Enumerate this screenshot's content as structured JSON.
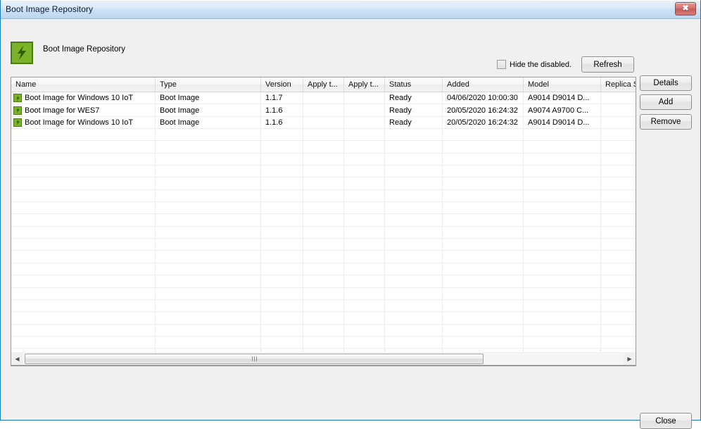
{
  "window": {
    "title": "Boot Image Repository",
    "close_icon": "close-icon",
    "close_glyph": "✖"
  },
  "header": {
    "icon": "lightning-bolt-icon",
    "caption": "Boot Image Repository"
  },
  "toolbar": {
    "hide_disabled_label": "Hide the disabled.",
    "hide_disabled_checked": false,
    "refresh_label": "Refresh"
  },
  "side_buttons": {
    "details_label": "Details",
    "add_label": "Add",
    "remove_label": "Remove"
  },
  "footer": {
    "close_label": "Close"
  },
  "grid": {
    "columns": [
      "Name",
      "Type",
      "Version",
      "Apply t...",
      "Apply t...",
      "Status",
      "Added",
      "Model",
      "Replica St"
    ],
    "rows": [
      {
        "icon": "lightning-bolt-icon",
        "name": "Boot Image for Windows 10 IoT",
        "type": "Boot Image",
        "version": "1.1.7",
        "apply_to_1": "",
        "apply_to_2": "",
        "status": "Ready",
        "added": "04/06/2020 10:00:30",
        "model": "A9014 D9014 D...",
        "replica_status": ""
      },
      {
        "icon": "lightning-bolt-icon",
        "name": "Boot Image for WES7",
        "type": "Boot Image",
        "version": "1.1.6",
        "apply_to_1": "",
        "apply_to_2": "",
        "status": "Ready",
        "added": "20/05/2020 16:24:32",
        "model": "A9074 A9700 C...",
        "replica_status": ""
      },
      {
        "icon": "lightning-bolt-icon",
        "name": "Boot Image for Windows 10 IoT",
        "type": "Boot Image",
        "version": "1.1.6",
        "apply_to_1": "",
        "apply_to_2": "",
        "status": "Ready",
        "added": "20/05/2020 16:24:32",
        "model": "A9014 D9014 D...",
        "replica_status": ""
      }
    ],
    "empty_row_count": 19
  },
  "scrollbar": {
    "left_arrow": "◀",
    "right_arrow": "▶",
    "orientation": "horizontal"
  },
  "colors": {
    "title_bar": "#cfe2f4",
    "window_border": "#1b7ac2",
    "icon_green": "#7cb228",
    "icon_green_dark": "#4b7a14",
    "close_red": "#c85a57",
    "dialog_background": "#f0f0f0"
  }
}
